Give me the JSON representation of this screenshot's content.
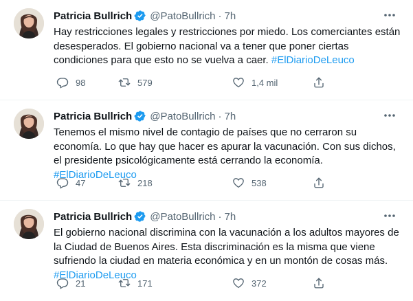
{
  "tweets": [
    {
      "author_name": "Patricia Bullrich",
      "handle": "@PatoBullrich",
      "separator": "·",
      "time": "7h",
      "text_plain": "Hay restricciones legales y restricciones por miedo. Los comerciantes están desesperados. El gobierno nacional va a tener que poner ciertas condiciones para que esto no se vuelva a caer. ",
      "hashtag": "#ElDiarioDeLeuco",
      "replies": "98",
      "retweets": "579",
      "likes": "1,4 mil",
      "share": ""
    },
    {
      "author_name": "Patricia Bullrich",
      "handle": "@PatoBullrich",
      "separator": "·",
      "time": "7h",
      "text_plain": "Tenemos el mismo nivel de contagio de países que no cerraron su economía. Lo que hay que hacer es apurar la vacunación. Con sus dichos, el presidente psicológicamente está cerrando la economía. ",
      "hashtag": "#ElDiarioDeLeuco",
      "replies": "47",
      "retweets": "218",
      "likes": "538",
      "share": ""
    },
    {
      "author_name": "Patricia Bullrich",
      "handle": "@PatoBullrich",
      "separator": "·",
      "time": "7h",
      "text_plain": "El gobierno nacional discrimina con la vacunación a los adultos mayores de la Ciudad de Buenos Aires. Esta discriminación es la misma que viene sufriendo la ciudad en materia económica y en un montón de cosas más. ",
      "hashtag": "#ElDiarioDeLeuco",
      "replies": "21",
      "retweets": "171",
      "likes": "372",
      "share": ""
    }
  ],
  "colors": {
    "text": "#0f1419",
    "secondary": "#536471",
    "accent": "#1d9bf0",
    "divider": "#eff3f4"
  },
  "icons": {
    "verified": "verified-badge-icon",
    "more": "more-options-icon",
    "reply": "reply-icon",
    "retweet": "retweet-icon",
    "like": "heart-icon",
    "share": "share-icon"
  }
}
